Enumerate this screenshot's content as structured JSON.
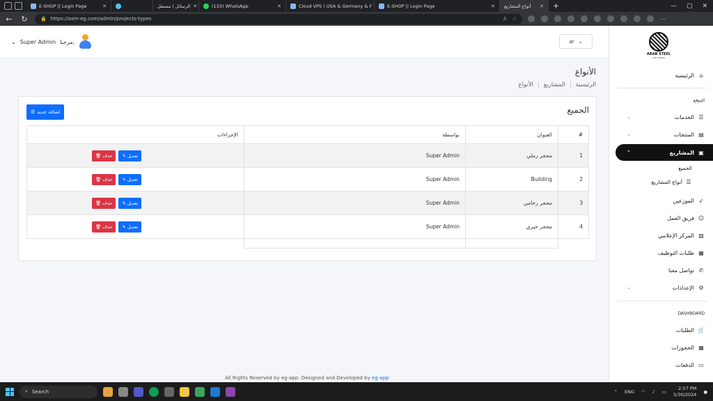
{
  "browser": {
    "tabs": [
      {
        "label": "E-SHOP || Login Page",
        "active": false
      },
      {
        "label": "",
        "active": false
      },
      {
        "label": "الرسائل | مستقل",
        "active": false
      },
      {
        "label": "(133) WhatsApp",
        "active": false
      },
      {
        "label": "Cloud VPS ( USA & Germany & F",
        "active": false
      },
      {
        "label": "E-SHOP || Login Page",
        "active": false
      },
      {
        "label": "أنواع المشاريع",
        "active": true
      }
    ],
    "url": "https://asm-eg.com/admin/projects-types"
  },
  "header": {
    "greeting": "مرحبا,",
    "user_name": "Super Admin",
    "lang_selector": "ar"
  },
  "page": {
    "title": "الأنواع",
    "breadcrumb": [
      "الرئيسية",
      "المشاريع",
      "الأنواع"
    ],
    "card_title": "الجميع",
    "add_button": "اضافة جديد"
  },
  "table": {
    "headers": [
      "#",
      "العنوان",
      "بواسطة",
      "الإجراءات"
    ],
    "edit_label": "تعديل",
    "delete_label": "حذف",
    "rows": [
      {
        "num": "1",
        "title": "محجر رملي",
        "by": "Super Admin"
      },
      {
        "num": "2",
        "title": "Building",
        "by": "Super Admin"
      },
      {
        "num": "3",
        "title": "محجر رخامي",
        "by": "Super Admin"
      },
      {
        "num": "4",
        "title": "محجر جيري",
        "by": "Super Admin"
      }
    ]
  },
  "footer": {
    "text": "All Rights Reserved by eg-app. Designed and Developed by",
    "brand": "eg-app"
  },
  "sidebar": {
    "logo_text": "ARAB STEEL",
    "logo_sub": "FOR MINING",
    "home": "الرئيسية",
    "section_site": "الموقع",
    "services": "الخدمات",
    "products": "المنتجات",
    "projects": "المشاريع",
    "projects_all": "الجميع",
    "projects_types": "أنواع المشاريع",
    "distributors": "الموزعين",
    "team": "فريق العمل",
    "media_center": "المركز الإعلامي",
    "jobs": "طلبات التوظيف",
    "contact": "تواصل معنا",
    "settings": "الإعدادات",
    "section_dashboard": "DASHBOARD",
    "orders": "الطلبات",
    "bookings": "الحجوزات",
    "payments": "الدفعات"
  },
  "taskbar": {
    "search": "Search",
    "lang": "ENG",
    "time": "2:57 PM",
    "date": "5/30/2024"
  },
  "colors": {
    "primary": "#0d6efd",
    "danger": "#dc3545",
    "sidebar_active": "#111111"
  }
}
